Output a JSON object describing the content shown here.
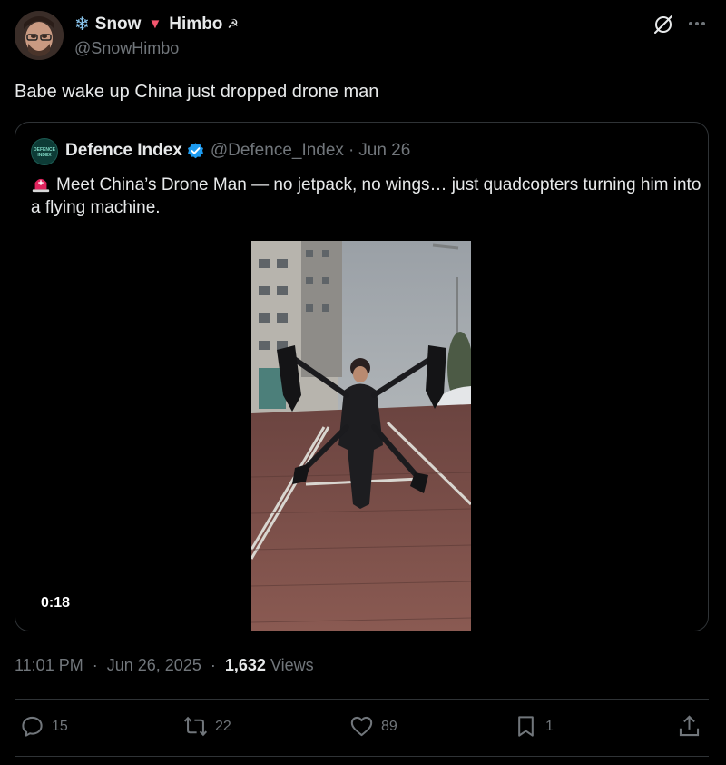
{
  "author": {
    "display_name_part1": "Snow",
    "display_name_part2": "Himbo",
    "handle": "@SnowHimbo"
  },
  "tweet": {
    "text": "Babe wake up China just dropped drone man"
  },
  "quoted": {
    "avatar_text": "DEFENCE INDEX",
    "name": "Defence Index",
    "handle": "@Defence_Index",
    "separator": "·",
    "date": "Jun 26",
    "text": "Meet China’s Drone Man — no jetpack, no wings… just quadcopters turning him into a flying machine.",
    "video_duration": "0:18"
  },
  "meta": {
    "time": "11:01 PM",
    "dot1": "·",
    "date": "Jun 26, 2025",
    "dot2": "·",
    "views_count": "1,632",
    "views_label": "Views"
  },
  "actions": {
    "replies": "15",
    "reposts": "22",
    "likes": "89",
    "bookmarks": "1"
  },
  "colors": {
    "background": "#000000",
    "text_primary": "#e7e9ea",
    "text_secondary": "#71767b",
    "border": "#2f3336",
    "verified": "#1d9bf0"
  },
  "icons": [
    "grok-icon",
    "more-icon",
    "verified-icon",
    "siren-icon",
    "reply-icon",
    "repost-icon",
    "like-icon",
    "bookmark-icon",
    "share-icon"
  ]
}
